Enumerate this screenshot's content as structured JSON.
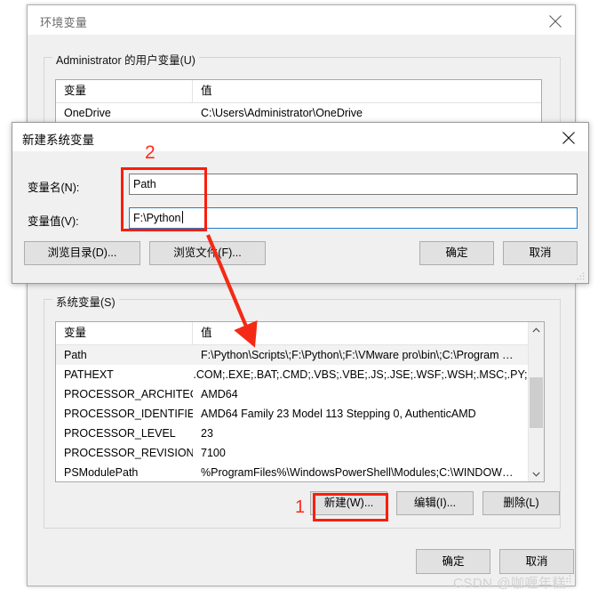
{
  "env_dialog": {
    "title": "环境变量",
    "close_icon": "close-icon",
    "user_group": {
      "legend": "Administrator 的用户变量(U)",
      "columns": [
        "变量",
        "值"
      ],
      "rows": [
        {
          "name": "OneDrive",
          "value": "C:\\Users\\Administrator\\OneDrive"
        }
      ]
    },
    "sys_group": {
      "legend": "系统变量(S)",
      "columns": [
        "变量",
        "值"
      ],
      "rows": [
        {
          "name": "Path",
          "value": "F:\\Python\\Scripts\\;F:\\Python\\;F:\\VMware pro\\bin\\;C:\\Program …",
          "selected": true
        },
        {
          "name": "PATHEXT",
          "value": ".COM;.EXE;.BAT;.CMD;.VBS;.VBE;.JS;.JSE;.WSF;.WSH;.MSC;.PY;.P…",
          "selected": false
        },
        {
          "name": "PROCESSOR_ARCHITECT…",
          "value": "AMD64",
          "selected": false
        },
        {
          "name": "PROCESSOR_IDENTIFIER",
          "value": "AMD64 Family 23 Model 113 Stepping 0, AuthenticAMD",
          "selected": false
        },
        {
          "name": "PROCESSOR_LEVEL",
          "value": "23",
          "selected": false
        },
        {
          "name": "PROCESSOR_REVISION",
          "value": "7100",
          "selected": false
        },
        {
          "name": "PSModulePath",
          "value": "%ProgramFiles%\\WindowsPowerShell\\Modules;C:\\WINDOW…",
          "selected": false
        }
      ],
      "buttons": {
        "new": "新建(W)...",
        "edit": "编辑(I)...",
        "delete": "删除(L)"
      },
      "scrollbar": {
        "up_icon": "chevron-up-icon",
        "down_icon": "chevron-down-icon"
      }
    },
    "footer": {
      "ok": "确定",
      "cancel": "取消"
    }
  },
  "new_var_dialog": {
    "title": "新建系统变量",
    "close_icon": "close-icon",
    "fields": {
      "name_label": "变量名(N):",
      "name_value": "Path",
      "name_placeholder": "",
      "value_label": "变量值(V):",
      "value_value": "F:\\Python",
      "value_placeholder": ""
    },
    "buttons": {
      "browse_dir": "浏览目录(D)...",
      "browse_file": "浏览文件(F)...",
      "ok": "确定",
      "cancel": "取消"
    }
  },
  "annotations": {
    "step1": "1",
    "step2": "2",
    "color": "#fc1d0b",
    "arrow": "red-arrow-icon"
  },
  "watermark": "CSDN @咖喱年糕"
}
